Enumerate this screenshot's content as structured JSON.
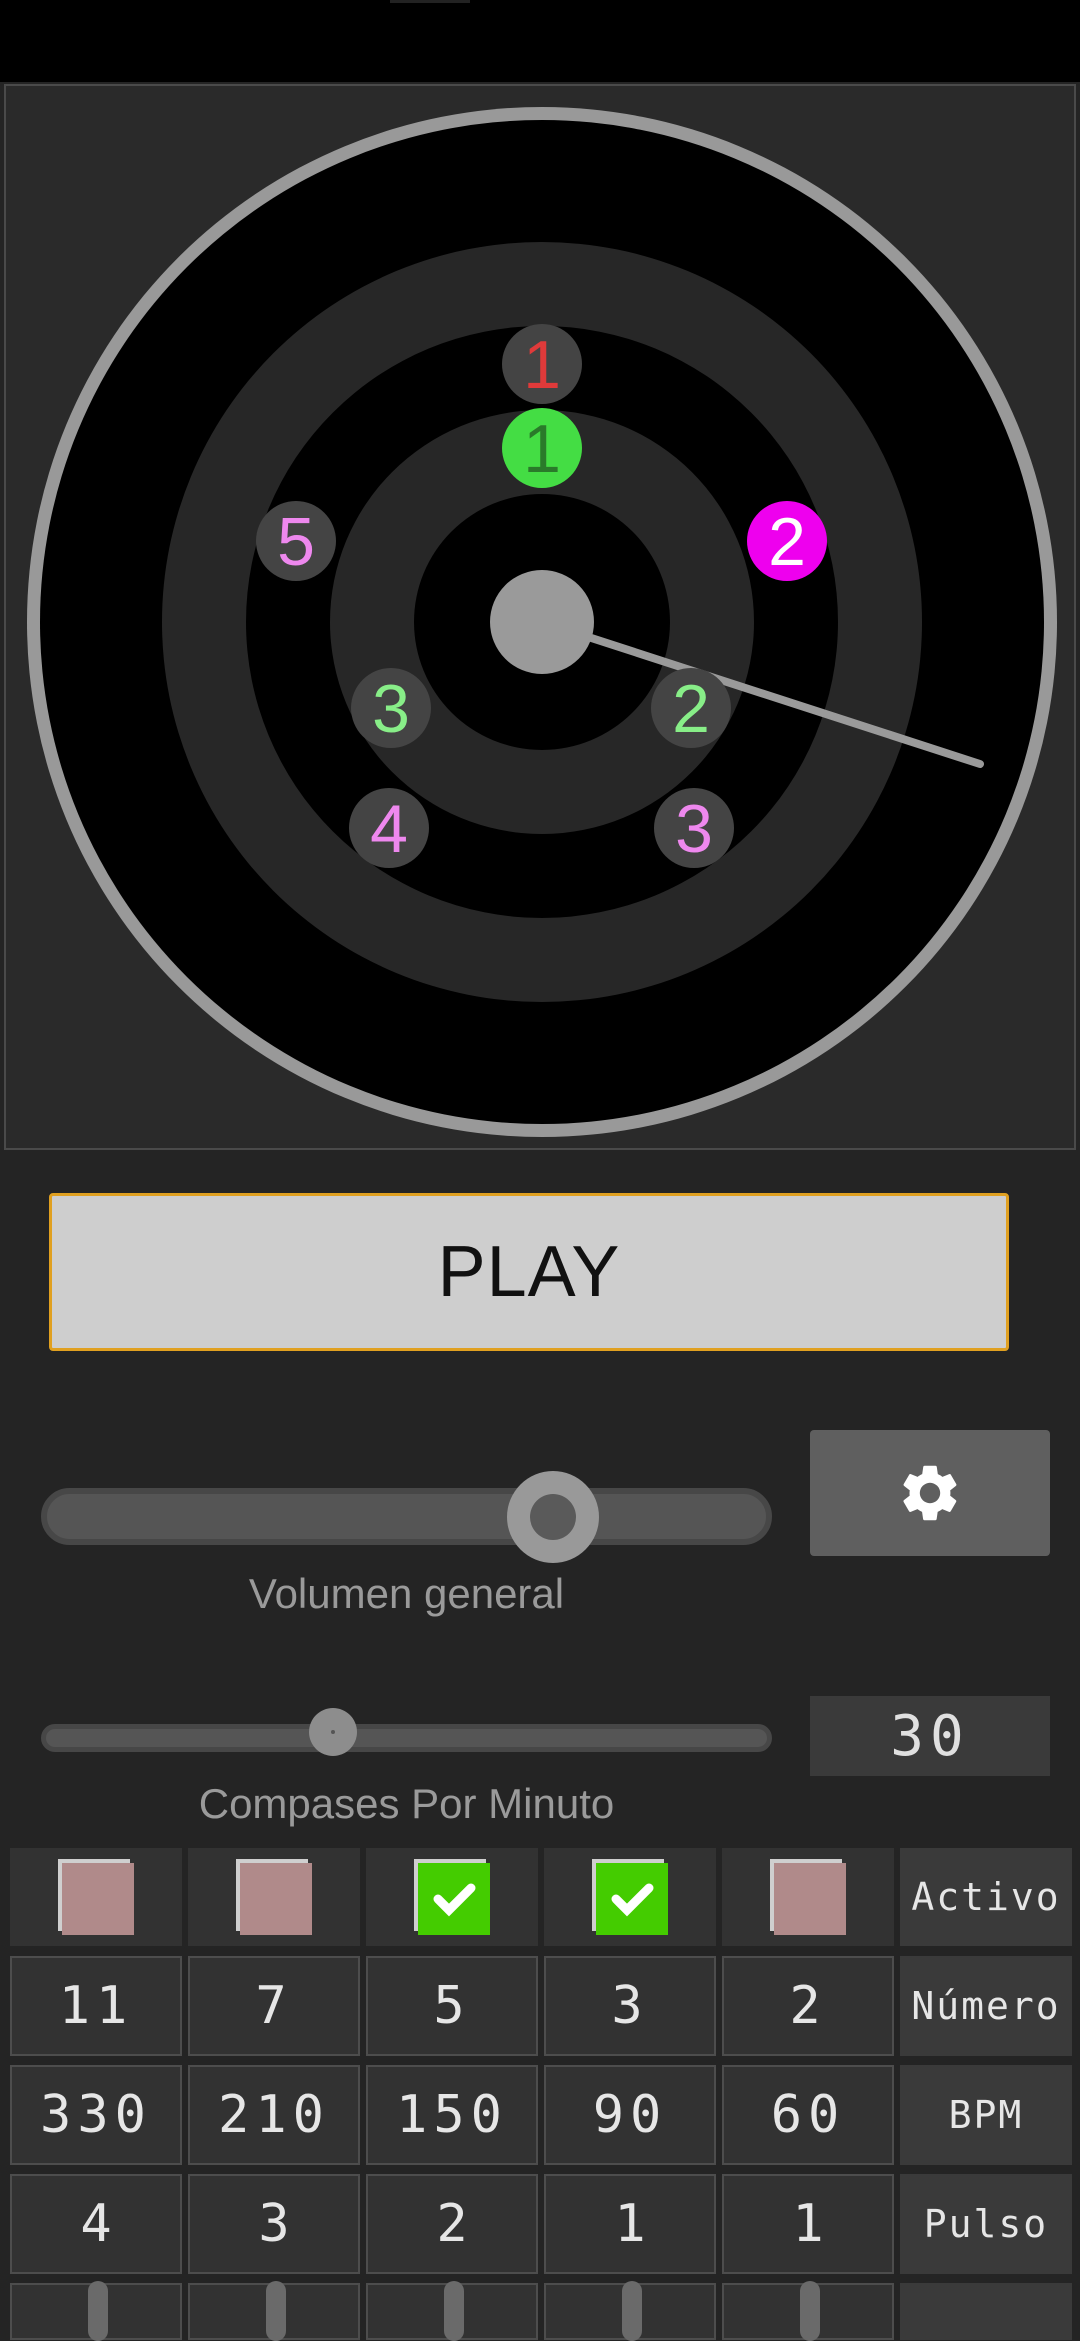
{
  "dial": {
    "markers": [
      {
        "label": "1",
        "text_color": "#e03a3a",
        "bg": "#444444"
      },
      {
        "label": "1",
        "text_color": "#2a7a2a",
        "bg": "#44dd44"
      },
      {
        "label": "2",
        "text_color": "#ffffff",
        "bg": "#ee00ee"
      },
      {
        "label": "5",
        "text_color": "#ee88ee",
        "bg": "#444444"
      },
      {
        "label": "3",
        "text_color": "#88ee88",
        "bg": "#444444"
      },
      {
        "label": "2",
        "text_color": "#88ee88",
        "bg": "#444444"
      },
      {
        "label": "4",
        "text_color": "#ee88ee",
        "bg": "#444444"
      },
      {
        "label": "3",
        "text_color": "#ee88ee",
        "bg": "#444444"
      }
    ]
  },
  "controls": {
    "play_label": "PLAY",
    "volume_label": "Volumen general",
    "volume_level": 0.7,
    "cpm_label": "Compases Por Minuto",
    "cpm_value": "30",
    "cpm_level": 0.4,
    "settings_icon": "gear-icon"
  },
  "table": {
    "row_labels": {
      "active": "Activo",
      "number": "Número",
      "bpm": "BPM",
      "pulse": "Pulso"
    },
    "columns": [
      {
        "active": false,
        "number": "11",
        "bpm": "330",
        "pulse": "4"
      },
      {
        "active": false,
        "number": "7",
        "bpm": "210",
        "pulse": "3"
      },
      {
        "active": true,
        "number": "5",
        "bpm": "150",
        "pulse": "2"
      },
      {
        "active": true,
        "number": "3",
        "bpm": "90",
        "pulse": "1"
      },
      {
        "active": false,
        "number": "2",
        "bpm": "60",
        "pulse": "1"
      }
    ]
  },
  "colors": {
    "check_on": "#44cc00",
    "check_off": "#b08a8a",
    "play_border": "#e0a020"
  }
}
